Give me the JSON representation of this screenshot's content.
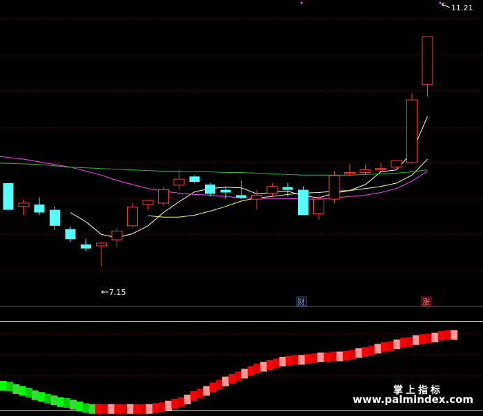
{
  "chart_data": {
    "type": "candlestick",
    "price_range": [
      6.9,
      11.45
    ],
    "annotations": {
      "high": "11.21",
      "low": "7.15",
      "event_a": "财",
      "event_b": "涨"
    },
    "colors": {
      "up": "#ff3c3c",
      "down": "#54ffff",
      "ma5": "#ffffff",
      "ma10": "#ffff66",
      "ma20": "#ff40ff",
      "ma60": "#20c020",
      "grid": "#7a1010",
      "divider": "#ffffff"
    },
    "candles": [
      {
        "o": 8.7,
        "h": 8.7,
        "l": 8.3,
        "c": 8.3
      },
      {
        "o": 8.35,
        "h": 8.45,
        "l": 8.22,
        "c": 8.4
      },
      {
        "o": 8.38,
        "h": 8.49,
        "l": 8.22,
        "c": 8.26
      },
      {
        "o": 8.3,
        "h": 8.35,
        "l": 8.0,
        "c": 8.06
      },
      {
        "o": 8.01,
        "h": 8.05,
        "l": 7.82,
        "c": 7.86
      },
      {
        "o": 7.78,
        "h": 7.86,
        "l": 7.68,
        "c": 7.72
      },
      {
        "o": 7.76,
        "h": 7.82,
        "l": 7.45,
        "c": 7.8
      },
      {
        "o": 7.85,
        "h": 8.02,
        "l": 7.74,
        "c": 7.98
      },
      {
        "o": 8.06,
        "h": 8.4,
        "l": 8.04,
        "c": 8.34
      },
      {
        "o": 8.38,
        "h": 8.45,
        "l": 8.3,
        "c": 8.44
      },
      {
        "o": 8.4,
        "h": 8.65,
        "l": 8.35,
        "c": 8.6
      },
      {
        "o": 8.67,
        "h": 8.9,
        "l": 8.6,
        "c": 8.76
      },
      {
        "o": 8.8,
        "h": 8.82,
        "l": 8.7,
        "c": 8.72
      },
      {
        "o": 8.68,
        "h": 8.7,
        "l": 8.5,
        "c": 8.54
      },
      {
        "o": 8.6,
        "h": 8.65,
        "l": 8.46,
        "c": 8.56
      },
      {
        "o": 8.52,
        "h": 8.74,
        "l": 8.46,
        "c": 8.48
      },
      {
        "o": 8.46,
        "h": 8.6,
        "l": 8.3,
        "c": 8.52
      },
      {
        "o": 8.55,
        "h": 8.7,
        "l": 8.5,
        "c": 8.65
      },
      {
        "o": 8.64,
        "h": 8.7,
        "l": 8.5,
        "c": 8.6
      },
      {
        "o": 8.6,
        "h": 8.65,
        "l": 8.22,
        "c": 8.22
      },
      {
        "o": 8.24,
        "h": 8.52,
        "l": 8.15,
        "c": 8.46
      },
      {
        "o": 8.46,
        "h": 8.88,
        "l": 8.4,
        "c": 8.81
      },
      {
        "o": 8.84,
        "h": 8.99,
        "l": 8.8,
        "c": 8.86
      },
      {
        "o": 8.86,
        "h": 8.98,
        "l": 8.82,
        "c": 8.9
      },
      {
        "o": 8.9,
        "h": 9.0,
        "l": 8.88,
        "c": 8.92
      },
      {
        "o": 8.94,
        "h": 9.04,
        "l": 8.94,
        "c": 9.04
      },
      {
        "o": 9.01,
        "h": 10.05,
        "l": 8.99,
        "c": 9.95
      },
      {
        "o": 10.18,
        "h": 10.9,
        "l": 10.0,
        "c": 10.9
      }
    ],
    "ma": [
      {
        "name": "MA5",
        "color": "#ffffff",
        "values": [
          null,
          null,
          null,
          null,
          8.26,
          8.12,
          7.93,
          7.88,
          7.94,
          8.06,
          8.26,
          8.42,
          8.57,
          8.62,
          8.64,
          8.63,
          8.54,
          8.56,
          8.58,
          8.51,
          8.48,
          8.55,
          8.59,
          8.68,
          8.87,
          8.9,
          9.16,
          9.7
        ]
      },
      {
        "name": "MA10",
        "color": "#ffff66",
        "values": [
          null,
          null,
          null,
          null,
          null,
          null,
          null,
          null,
          null,
          8.21,
          8.19,
          8.19,
          8.22,
          8.28,
          8.35,
          8.43,
          8.48,
          8.5,
          8.53,
          8.55,
          8.56,
          8.58,
          8.59,
          8.62,
          8.65,
          8.7,
          8.82,
          9.06
        ]
      },
      {
        "name": "MA20",
        "color": "#ff40ff",
        "values": [
          9.1,
          9.06,
          9.02,
          8.98,
          8.94,
          8.88,
          8.82,
          8.74,
          8.68,
          8.62,
          8.58,
          8.55,
          8.53,
          8.52,
          8.5,
          8.48,
          8.47,
          8.47,
          8.47,
          8.46,
          8.46,
          8.48,
          8.5,
          8.52,
          8.56,
          8.62,
          8.73,
          8.88
        ]
      },
      {
        "name": "MA60",
        "color": "#20c020",
        "values": [
          9.0,
          8.99,
          8.98,
          8.96,
          8.94,
          8.93,
          8.92,
          8.91,
          8.9,
          8.89,
          8.88,
          8.88,
          8.87,
          8.87,
          8.86,
          8.86,
          8.85,
          8.84,
          8.83,
          8.82,
          8.82,
          8.82,
          8.82,
          8.83,
          8.84,
          8.85,
          8.87,
          8.9
        ]
      }
    ],
    "indicator": {
      "range": [
        0,
        100
      ],
      "values": [
        28,
        27,
        24,
        22,
        20,
        17,
        15,
        13,
        11,
        9,
        8,
        6,
        4,
        2,
        1,
        1,
        1,
        1,
        1,
        1,
        1,
        1,
        1,
        1,
        2,
        3,
        5,
        7,
        9,
        12,
        16,
        19,
        22,
        26,
        29,
        33,
        36,
        39,
        42,
        45,
        48,
        50,
        52,
        54,
        56,
        57,
        58,
        58,
        59,
        60,
        61,
        61,
        62,
        62,
        63,
        64,
        66,
        67,
        69,
        71,
        73,
        74,
        76,
        78,
        79,
        81,
        82,
        83,
        84,
        86,
        87,
        87
      ],
      "up_colors": [
        "#ff0000",
        "#dd0000",
        "#ff9999"
      ],
      "down_colors": [
        "#00ff00",
        "#00cc00",
        "#33dd33"
      ]
    }
  },
  "watermark": {
    "line1": "掌上指标",
    "line2": "www.palmindex.com"
  }
}
